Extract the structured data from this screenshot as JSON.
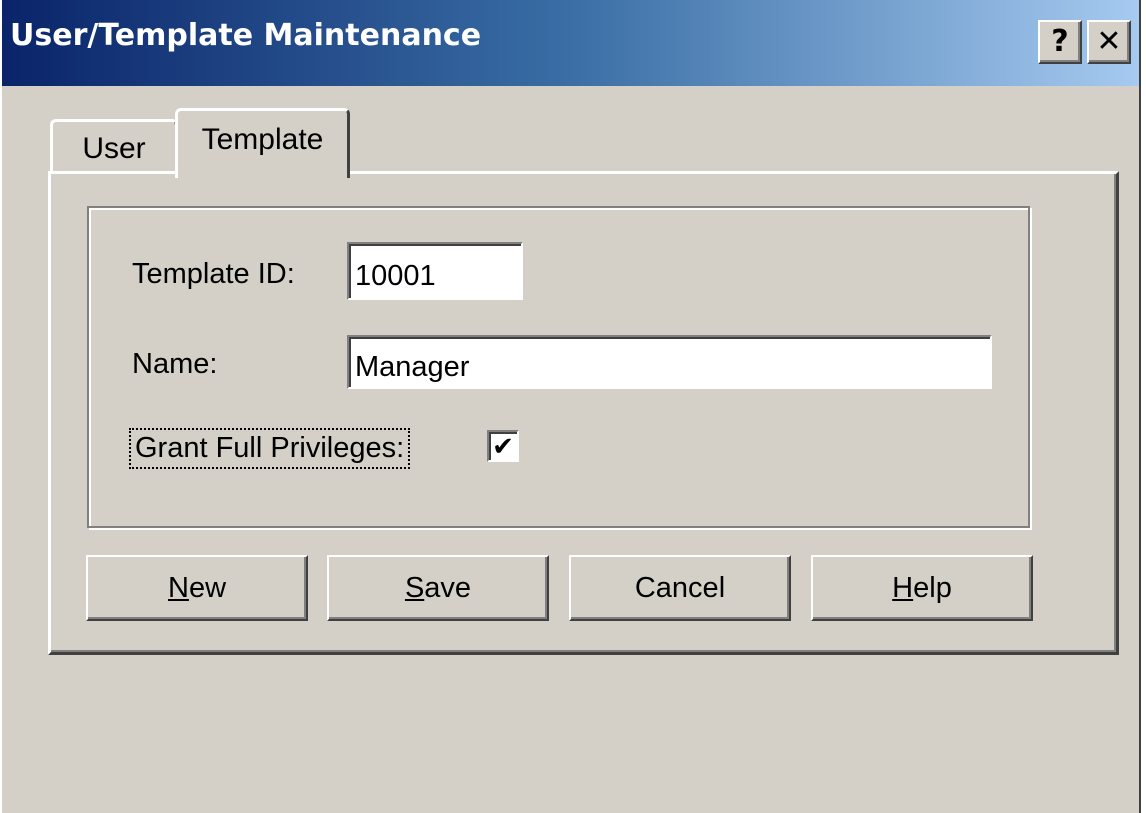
{
  "window": {
    "title": "User/Template Maintenance",
    "help_glyph": "?",
    "close_glyph": "✕"
  },
  "tabs": [
    {
      "label": "User",
      "selected": false
    },
    {
      "label": "Template",
      "selected": true
    }
  ],
  "form": {
    "template_id_label": "Template ID:",
    "template_id_value": "10001",
    "name_label": "Name:",
    "name_value": "Manager",
    "grant_label": "Grant Full Privileges:",
    "grant_checked": true,
    "check_glyph": "✔"
  },
  "buttons": {
    "new": {
      "mnemonic": "N",
      "rest": "ew"
    },
    "save": {
      "mnemonic": "S",
      "rest": "ave"
    },
    "cancel": {
      "label": "Cancel"
    },
    "help": {
      "mnemonic": "H",
      "rest": "elp"
    }
  }
}
